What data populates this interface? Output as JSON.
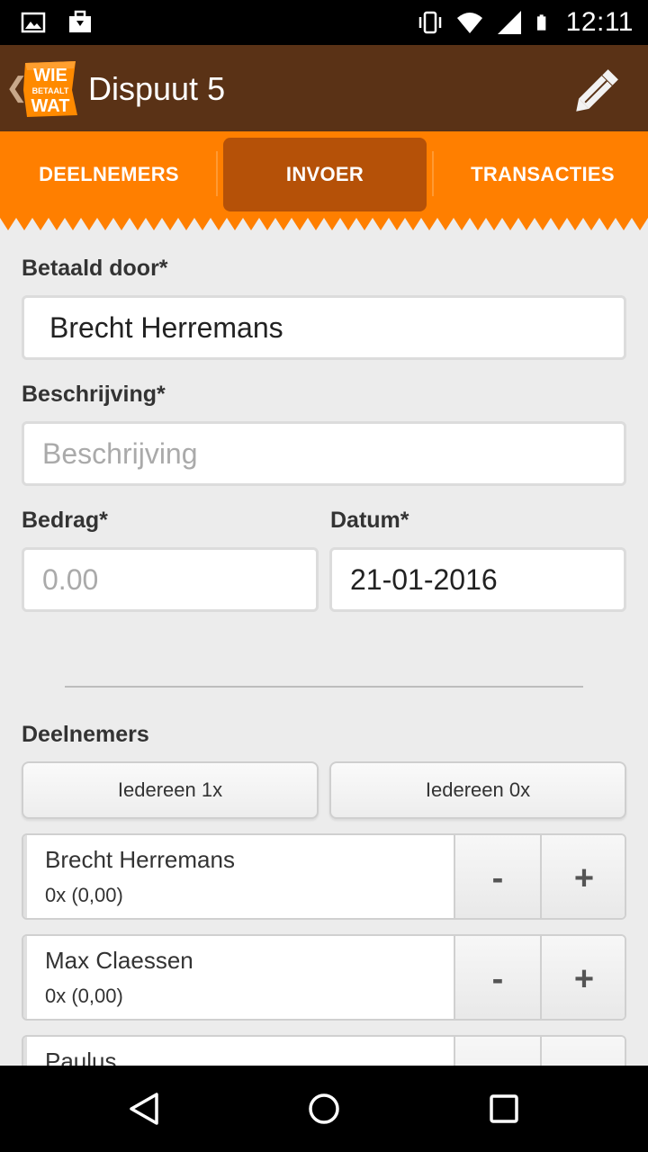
{
  "status_bar": {
    "time": "12:11",
    "icons": [
      "image-icon",
      "briefcase-download-icon",
      "vibrate-icon",
      "wifi-icon",
      "cell-signal-icon",
      "battery-icon"
    ]
  },
  "app_bar": {
    "title": "Dispuut 5",
    "logo": {
      "line1": "WIE",
      "line2": "BETAALT",
      "line3": "WAT"
    },
    "edit_icon": "pencil-icon",
    "back_icon": "chevron-left-icon"
  },
  "tabs": [
    {
      "label": "DEELNEMERS",
      "active": false
    },
    {
      "label": "INVOER",
      "active": true
    },
    {
      "label": "TRANSACTIES",
      "active": false
    }
  ],
  "form": {
    "paid_by": {
      "label": "Betaald door*",
      "value": "Brecht Herremans"
    },
    "description": {
      "label": "Beschrijving*",
      "placeholder": "Beschrijving",
      "value": ""
    },
    "amount": {
      "label": "Bedrag*",
      "placeholder": "0.00",
      "value": ""
    },
    "date": {
      "label": "Datum*",
      "value": "21-01-2016"
    }
  },
  "participants_section": {
    "heading": "Deelnemers",
    "everyone_1x": "Iedereen 1x",
    "everyone_0x": "Iedereen 0x",
    "minus_label": "-",
    "plus_label": "+",
    "items": [
      {
        "name": "Brecht Herremans",
        "share": "0x (0,00)"
      },
      {
        "name": "Max Claessen",
        "share": "0x (0,00)"
      },
      {
        "name": "Paulus",
        "share": ""
      }
    ]
  },
  "nav_bar": {
    "icons": [
      "back-triangle-icon",
      "home-circle-icon",
      "recents-square-icon"
    ]
  },
  "colors": {
    "app_bar": "#5a3216",
    "tab_bar": "#ff7f00",
    "tab_active": "#b55108",
    "background": "#ececec"
  }
}
